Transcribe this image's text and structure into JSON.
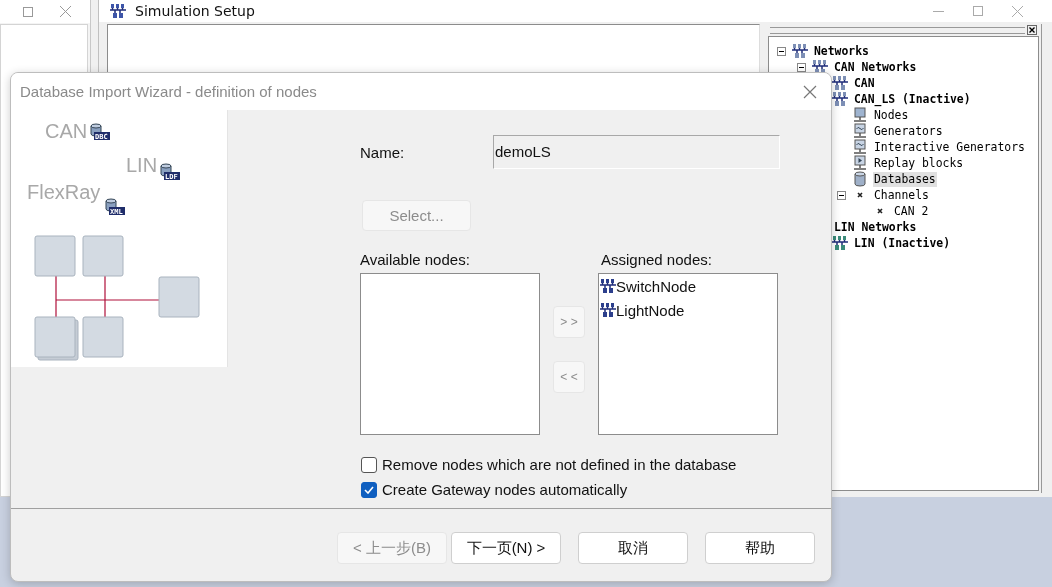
{
  "simulation_window": {
    "title": "Simulation Setup"
  },
  "tree": [
    {
      "label": "Networks",
      "kind": "network",
      "expanded": true,
      "selected": false,
      "children": [
        {
          "label": "CAN Networks",
          "kind": "network",
          "expanded": true,
          "selected": false,
          "children": [
            {
              "label": "CAN",
              "kind": "network",
              "selected": false
            },
            {
              "label": "CAN_LS (Inactive)",
              "kind": "network",
              "selected": false,
              "children": [
                {
                  "label": "Nodes",
                  "kind": "node",
                  "selected": false
                },
                {
                  "label": "Generators",
                  "kind": "generator",
                  "selected": false
                },
                {
                  "label": "Interactive Generators",
                  "kind": "generator",
                  "selected": false
                },
                {
                  "label": "Replay blocks",
                  "kind": "replay",
                  "selected": false
                },
                {
                  "label": "Databases",
                  "kind": "database",
                  "selected": true
                },
                {
                  "label": "Channels",
                  "kind": "channel",
                  "expanded": true,
                  "selected": false,
                  "children": [
                    {
                      "label": "CAN 2",
                      "kind": "channel",
                      "selected": false
                    }
                  ]
                }
              ]
            }
          ]
        },
        {
          "label": "LIN Networks",
          "kind": "heading",
          "selected": false,
          "children": [
            {
              "label": "LIN (Inactive)",
              "kind": "lin",
              "selected": false
            }
          ]
        }
      ]
    }
  ],
  "dialog": {
    "title": "Database Import Wizard - definition of nodes",
    "illustration": {
      "labels": [
        {
          "text": "CAN",
          "badge": "DBC"
        },
        {
          "text": "LIN",
          "badge": "LDF"
        },
        {
          "text": "FlexRay",
          "badge": "XML"
        }
      ]
    },
    "name_label": "Name:",
    "name_value": "demoLS",
    "select_button": {
      "label": "Select...",
      "disabled": true
    },
    "available_label": "Available nodes:",
    "assigned_label": "Assigned nodes:",
    "assigned_nodes": [
      {
        "name": "SwitchNode"
      },
      {
        "name": "LightNode"
      }
    ],
    "move_buttons": [
      {
        "label": "> >",
        "disabled": true
      },
      {
        "label": "< <",
        "disabled": true
      }
    ],
    "options": [
      {
        "label": "Remove nodes which are not defined in the database",
        "checked": false
      },
      {
        "label": "Create Gateway nodes automatically",
        "checked": true
      }
    ],
    "buttons": [
      {
        "label": "< 上一步(B)",
        "disabled": true
      },
      {
        "label": "下一页(N) >",
        "disabled": false
      },
      {
        "label": "取消",
        "disabled": false
      },
      {
        "label": "帮助",
        "disabled": false
      }
    ]
  }
}
